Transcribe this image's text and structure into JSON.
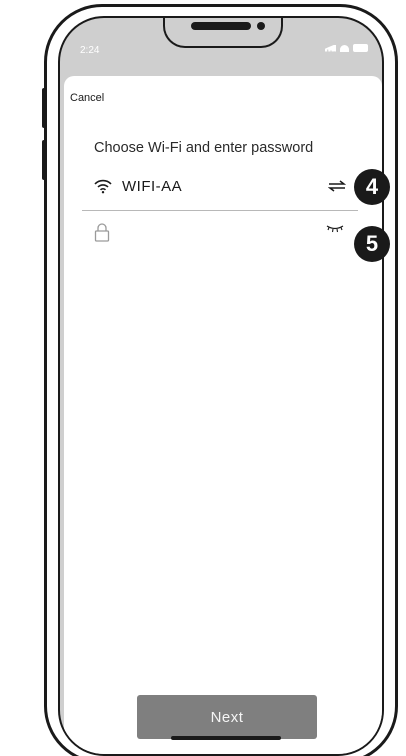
{
  "status_bar": {
    "time": "2:24"
  },
  "header": {
    "cancel_label": "Cancel"
  },
  "main": {
    "prompt": "Choose Wi-Fi and enter password",
    "wifi": {
      "network_name": "WIFI-AA",
      "icon": "wifi-icon",
      "action_icon": "swap-icon"
    },
    "password": {
      "value": "",
      "placeholder": "",
      "icon": "lock-icon",
      "toggle_icon": "eye-closed-icon"
    },
    "next_label": "Next"
  },
  "annotations": {
    "badge_4": "4",
    "badge_5": "5"
  },
  "colors": {
    "status_bar_bg": "#cfcfcf",
    "button_bg": "#7f7f7f",
    "badge_bg": "#1a1a1a",
    "divider": "#b8b8b8"
  }
}
